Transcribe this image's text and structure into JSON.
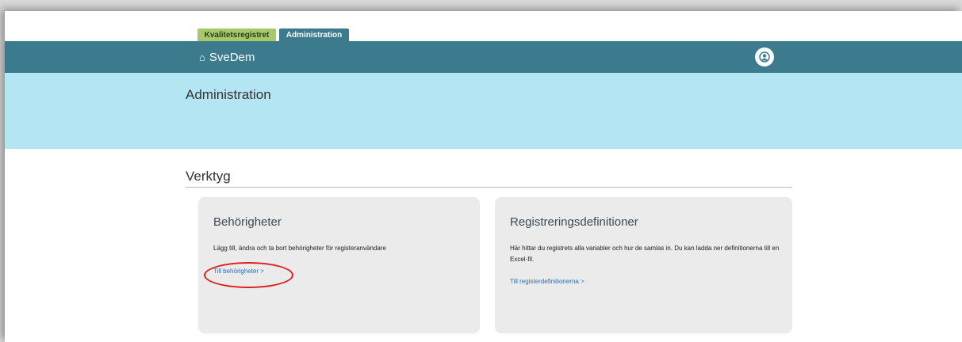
{
  "tabs": [
    {
      "label": "Kvalitetsregistret"
    },
    {
      "label": "Administration"
    }
  ],
  "header": {
    "brand": "SveDem",
    "home_icon": "home-icon",
    "avatar_icon": "user-avatar-icon"
  },
  "hero": {
    "title": "Administration"
  },
  "section": {
    "title": "Verktyg"
  },
  "cards": [
    {
      "title": "Behörigheter",
      "description": "Lägg till, ändra och ta bort behörigheter för registeranvändare",
      "link": "Till behörigheter >"
    },
    {
      "title": "Registreringsdefinitioner",
      "description": "Här hittar du registrets alla variabler och hur de samlas in. Du kan ladda ner definitionerna till en Excel-fil.",
      "link": "Till registerdefinitionerna >"
    }
  ],
  "colors": {
    "topbar": "#3b7b8d",
    "hero": "#b4e5f3",
    "tab_active": "#3b7b8d",
    "tab_inactive": "#a7c969",
    "link": "#2a6fb8",
    "annotation": "#e01e1e"
  }
}
